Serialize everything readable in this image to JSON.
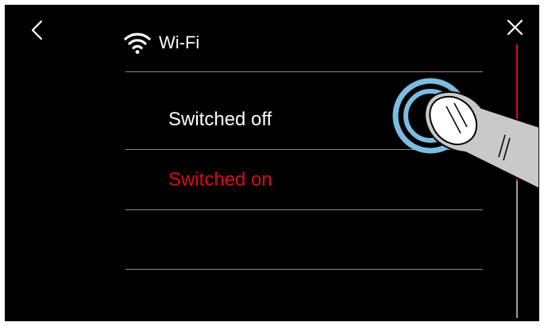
{
  "header": {
    "title": "Wi-Fi",
    "back_icon": "chevron-left-icon",
    "close_icon": "close-icon",
    "wifi_icon": "wifi-icon"
  },
  "options": [
    {
      "label": "Switched off",
      "selected": false
    },
    {
      "label": "Switched on",
      "selected": true
    }
  ],
  "colors": {
    "background": "#000000",
    "text": "#ffffff",
    "accent": "#e30613",
    "divider": "#8a8a8a",
    "touch_ring": "#7bbcdf"
  },
  "scrollbar": {
    "position_fraction": 0.0,
    "visible_fraction": 0.5
  }
}
